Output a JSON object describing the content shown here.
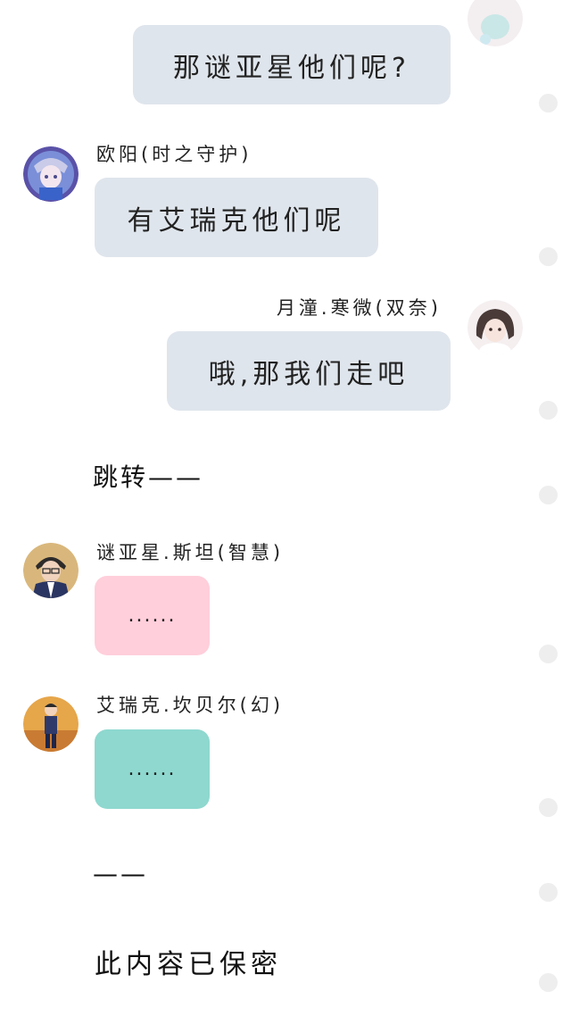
{
  "colors": {
    "bubble_gray": "#dfe5ec",
    "bubble_pink": "#ffcfdb",
    "bubble_teal": "#8ed8cf",
    "dot_gray": "#eeeeee"
  },
  "messages": [
    {
      "side": "right",
      "sender": "",
      "text": "那谜亚星他们呢?",
      "avatar": "girl-avatar"
    },
    {
      "side": "left",
      "sender": "欧阳(时之守护)",
      "text": "有艾瑞克他们呢",
      "avatar": "anime-boy-avatar"
    },
    {
      "side": "right",
      "sender": "月潼.寒微(双奈)",
      "text": "哦,那我们走吧",
      "avatar": "girl-avatar"
    },
    {
      "side": "left",
      "sender": "谜亚星.斯坦(智慧)",
      "text": "......",
      "avatar": "boy-suit-avatar"
    },
    {
      "side": "left",
      "sender": "艾瑞克.坎贝尔(幻)",
      "text": "......",
      "avatar": "boy-stage-avatar"
    }
  ],
  "narration": {
    "jump": "跳转——",
    "dash": "——",
    "classified": "此内容已保密"
  }
}
